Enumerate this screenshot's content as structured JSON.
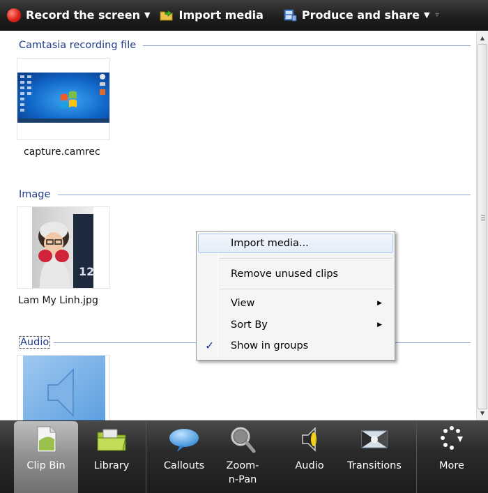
{
  "toolbar": {
    "record_label": "Record the screen",
    "import_label": "Import media",
    "produce_label": "Produce and share"
  },
  "groups": {
    "recording": {
      "title": "Camtasia recording file",
      "clip_name": "capture.camrec"
    },
    "image": {
      "title": "Image",
      "clip_name": "Lam My Linh.jpg"
    },
    "audio": {
      "title": "Audio"
    }
  },
  "context_menu": {
    "items": [
      {
        "label": "Import media...",
        "highlighted": true
      },
      {
        "label": "Remove unused clips"
      },
      {
        "label": "View",
        "submenu": true
      },
      {
        "label": "Sort By",
        "submenu": true
      },
      {
        "label": "Show in groups",
        "checked": true
      }
    ]
  },
  "tabs": [
    {
      "label": "Clip Bin",
      "icon": "clip-bin-icon",
      "active": true
    },
    {
      "label": "Library",
      "icon": "library-folder-icon"
    },
    {
      "label": "Callouts",
      "icon": "speech-bubble-icon"
    },
    {
      "label": "Zoom-n-Pan",
      "icon": "magnifier-icon"
    },
    {
      "label": "Audio",
      "icon": "speaker-icon"
    },
    {
      "label": "Transitions",
      "icon": "transitions-icon"
    },
    {
      "label": "More",
      "icon": "more-dots-icon"
    }
  ],
  "colors": {
    "group_title": "#1f3c88",
    "toolbar_bg": "#1e1e1e",
    "menu_highlight": "#e3ecf8"
  }
}
